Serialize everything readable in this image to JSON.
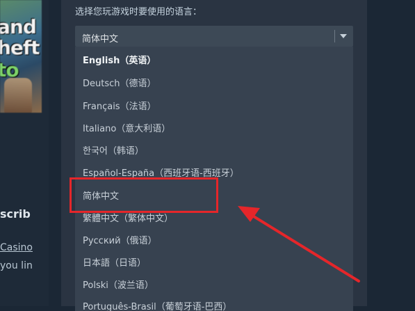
{
  "left_panel": {
    "game_logo_lines": [
      "and",
      "heft",
      "to"
    ],
    "subscribe": "scrib",
    "casino": "Casino",
    "link": "you lin"
  },
  "dialog": {
    "prompt": "选择您玩游戏时要使用的语言：",
    "select": {
      "value": "简体中文",
      "caret_icon": "chevron-down-icon"
    },
    "options": [
      "English（英语）",
      "Deutsch（德语）",
      "Français（法语）",
      "Italiano（意大利语）",
      "한국어（韩语）",
      "Español-España（西班牙语-西班牙）",
      "简体中文",
      "繁體中文（繁体中文）",
      "Русский（俄语）",
      "日本語（日语）",
      "Polski（波兰语）",
      "Português-Brasil（葡萄牙语-巴西）"
    ],
    "active_index": 0,
    "highlighted_index": 6
  },
  "annotation": {
    "color": "#e5262a"
  }
}
